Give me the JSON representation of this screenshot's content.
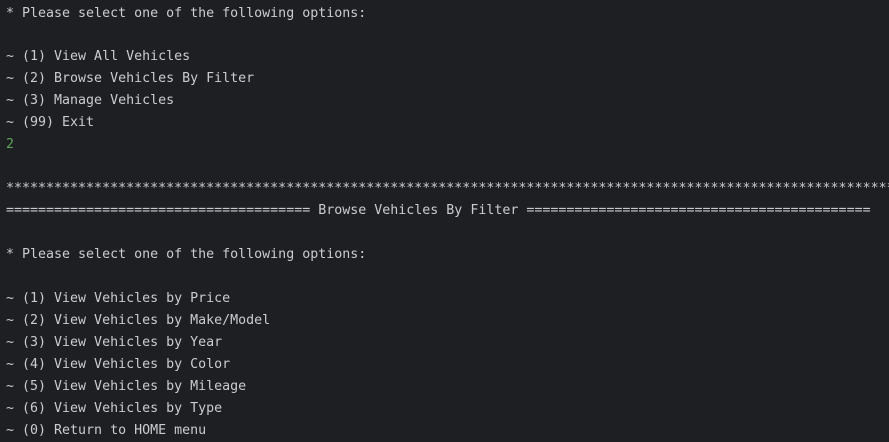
{
  "colors": {
    "background": "#1e1f22",
    "text": "#c9ccd1",
    "user_input": "#5da35b"
  },
  "home_menu": {
    "prompt": "* Please select one of the following options:",
    "options": [
      "~ (1) View All Vehicles",
      "~ (2) Browse Vehicles By Filter",
      "~ (3) Manage Vehicles",
      "~ (99) Exit"
    ]
  },
  "user_input": "2",
  "banner": {
    "stars": "*******************************************************************************************************************",
    "title": "====================================== Browse Vehicles By Filter ==========================================="
  },
  "filter_menu": {
    "prompt": "* Please select one of the following options:",
    "options": [
      "~ (1) View Vehicles by Price",
      "~ (2) View Vehicles by Make/Model",
      "~ (3) View Vehicles by Year",
      "~ (4) View Vehicles by Color",
      "~ (5) View Vehicles by Mileage",
      "~ (6) View Vehicles by Type",
      "~ (0) Return to HOME menu"
    ]
  }
}
